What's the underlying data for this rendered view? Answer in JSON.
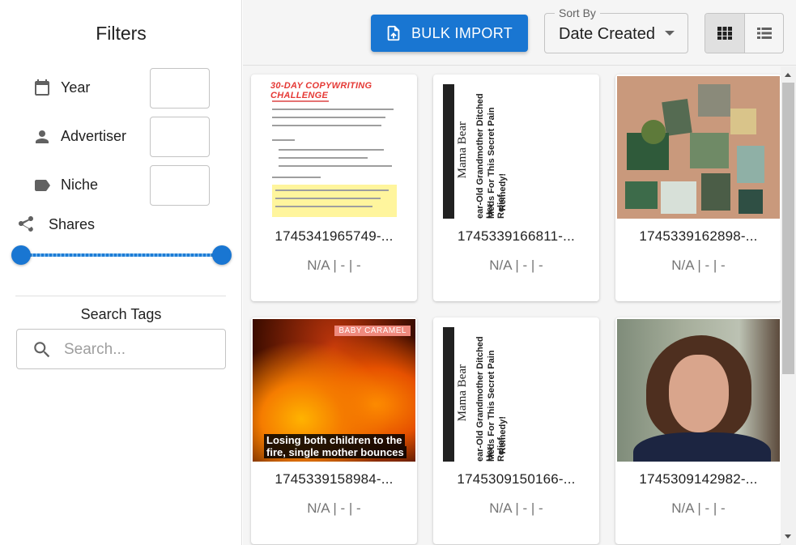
{
  "sidebar": {
    "title": "Filters",
    "filters": [
      {
        "label": "Year",
        "icon": "calendar-icon"
      },
      {
        "label": "Advertiser",
        "icon": "person-icon"
      },
      {
        "label": "Niche",
        "icon": "label-icon"
      }
    ],
    "shares": {
      "label": "Shares",
      "icon": "share-icon",
      "range_min_fraction": 0.0,
      "range_max_fraction": 1.0
    },
    "search_tags": {
      "title": "Search Tags",
      "placeholder": "Search...",
      "value": ""
    }
  },
  "toolbar": {
    "bulk_import_label": "BULK IMPORT",
    "sort": {
      "label": "Sort By",
      "value": "Date Created"
    },
    "view_modes": [
      "grid",
      "list"
    ],
    "active_view": "grid"
  },
  "cards": [
    {
      "name": "1745341965749-...",
      "meta": "N/A | - | -",
      "thumb": "30-DAY COPYWRITING CHALLENGE"
    },
    {
      "name": "1745339166811-...",
      "meta": "N/A | - | -",
      "thumb": "Mama Bear"
    },
    {
      "name": "1745339162898-...",
      "meta": "N/A | - | -",
      "thumb": ""
    },
    {
      "name": "1745339158984-...",
      "meta": "N/A | - | -",
      "thumb_badge": "BABY CARAMEL",
      "thumb_caption_1": "Losing both children to the",
      "thumb_caption_2": "fire, single mother bounces"
    },
    {
      "name": "1745309150166-...",
      "meta": "N/A | - | -",
      "thumb": "Mama Bear"
    },
    {
      "name": "1745309142982-...",
      "meta": "N/A | - | -",
      "thumb": ""
    }
  ],
  "thumb_text": {
    "mama_brand": "Mama Bear",
    "mama_headline_1": "ear-Old Grandmother Ditched Her",
    "mama_headline_2": "Meds For This Secret Pain Relief",
    "mama_headline_3": "Remedy!"
  },
  "colors": {
    "accent": "#1976d2",
    "sidebar_bg": "#ffffff",
    "main_bg": "#f5f5f5"
  }
}
